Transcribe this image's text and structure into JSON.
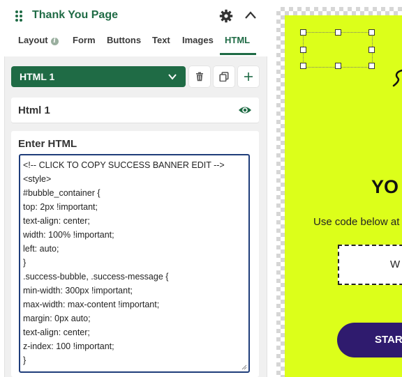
{
  "header": {
    "title": "Thank You Page"
  },
  "tabs": [
    {
      "label": "Layout"
    },
    {
      "label": "Form"
    },
    {
      "label": "Buttons"
    },
    {
      "label": "Text"
    },
    {
      "label": "Images"
    },
    {
      "label": "HTML"
    }
  ],
  "selector": {
    "value": "HTML 1"
  },
  "block": {
    "name": "Html 1"
  },
  "editor": {
    "title": "Enter HTML",
    "lines": [
      "<!-- CLICK TO COPY SUCCESS BANNER EDIT -->",
      "<style>",
      "#bubble_container {",
      "top: 2px !important;",
      "text-align: center;",
      "width: 100% !important;",
      "left: auto;",
      "}",
      ".success-bubble, .success-message {",
      "min-width: 300px !important;",
      "max-width: max-content !important;",
      "margin: 0px auto;",
      "text-align: center;",
      "z-index: 100 !important;",
      "}"
    ]
  },
  "preview": {
    "heading": "YO",
    "subtext": "Use code below at",
    "code_text": "W",
    "button_label": "STAR"
  },
  "colors": {
    "brand_green": "#1f6b45",
    "preview_bg": "#dcff1a",
    "button_purple": "#2f1b6e"
  }
}
